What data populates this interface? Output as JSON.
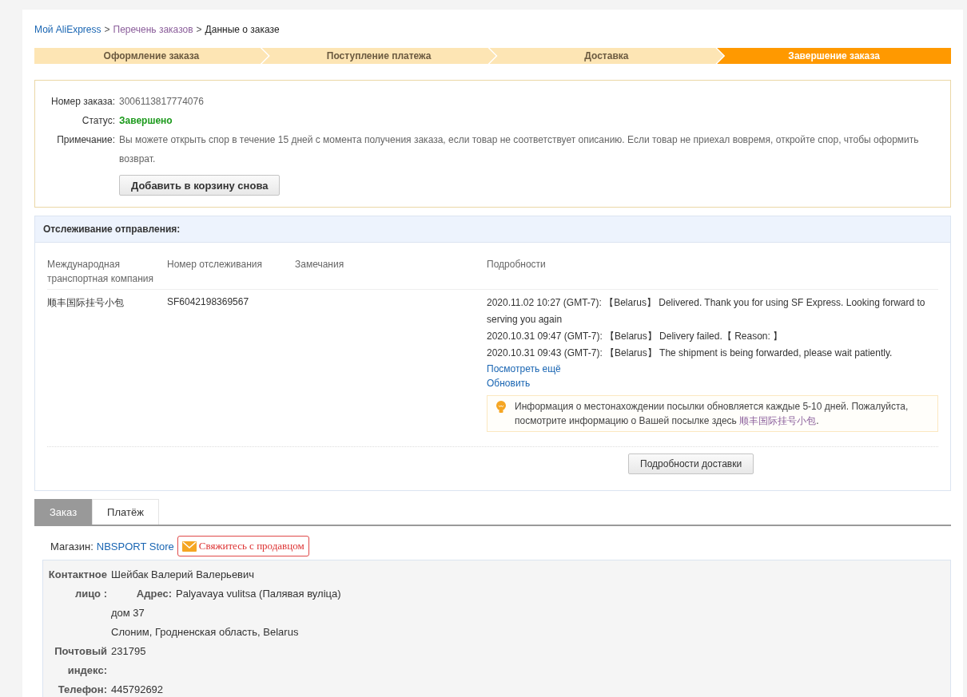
{
  "breadcrumb_separator": ">",
  "breadcrumb": [
    {
      "label": "Мой AliExpress",
      "kind": "link"
    },
    {
      "label": "Перечень заказов",
      "kind": "visited"
    },
    {
      "label": "Данные о заказе",
      "kind": "current"
    }
  ],
  "steps": [
    {
      "label": "Оформление заказа",
      "selected": false
    },
    {
      "label": "Поступление платежа",
      "selected": false
    },
    {
      "label": "Доставка",
      "selected": false
    },
    {
      "label": "Завершение заказа",
      "selected": true
    }
  ],
  "order": {
    "fields": [
      {
        "label": "Номер заказа:",
        "value": "3006113817774076",
        "kind": "plain"
      },
      {
        "label": "Статус:",
        "value": "Завершено",
        "kind": "status"
      },
      {
        "label": "Примечание:",
        "value": "Вы можете открыть спор в течение 15 дней с момента получения заказа, если товар не соответствует описанию. Если товар не приехал вовремя, откройте спор, чтобы оформить возврат.",
        "kind": "plain"
      }
    ],
    "button": "Добавить в корзину снова"
  },
  "tracking": {
    "title": "Отслеживание отправления:",
    "columns": [
      "Международная транспортная компания",
      "Номер отслеживания",
      "Замечания",
      "Подробности"
    ],
    "carrier": "顺丰国际挂号小包",
    "number": "SF6042198369567",
    "events": [
      "2020.11.02 10:27 (GMT-7): 【Belarus】 Delivered. Thank you for using SF Express. Looking forward to serving you again",
      "2020.10.31 09:47 (GMT-7): 【Belarus】 Delivery failed.【 Reason: 】",
      "2020.10.31 09:43 (GMT-7): 【Belarus】 The shipment is being forwarded, please wait patiently."
    ],
    "more_link": "Посмотреть ещё",
    "refresh_link": "Обновить",
    "notice": {
      "before": "Информация о местонахождении посылки обновляется каждые 5-10 дней. Пожалуйста, посмотрите информацию о Вашей посылке здесь ",
      "link": "顺丰国际挂号小包",
      "after": "."
    },
    "details_button": "Подробности доставки"
  },
  "tabs": [
    {
      "label": "Заказ",
      "selected": true
    },
    {
      "label": "Платёж",
      "selected": false
    }
  ],
  "store": {
    "label": "Магазин:",
    "name": "NBSPORT Store",
    "contact_button": "Свяжитесь с продавцом"
  },
  "contact": {
    "person_label": "Контактное лицо :",
    "person": "Шейбак Валерий Валерьевич",
    "address_label": "Адрес:",
    "address_lines": [
      "Palyavaya vulitsa (Палявая вуліца)",
      "дом 37",
      "Слоним, Гродненская область, Belarus"
    ],
    "postal_label": "Почтовый индекс:",
    "postal": "231795",
    "phone_label": "Телефон:",
    "phone": "445792692"
  }
}
